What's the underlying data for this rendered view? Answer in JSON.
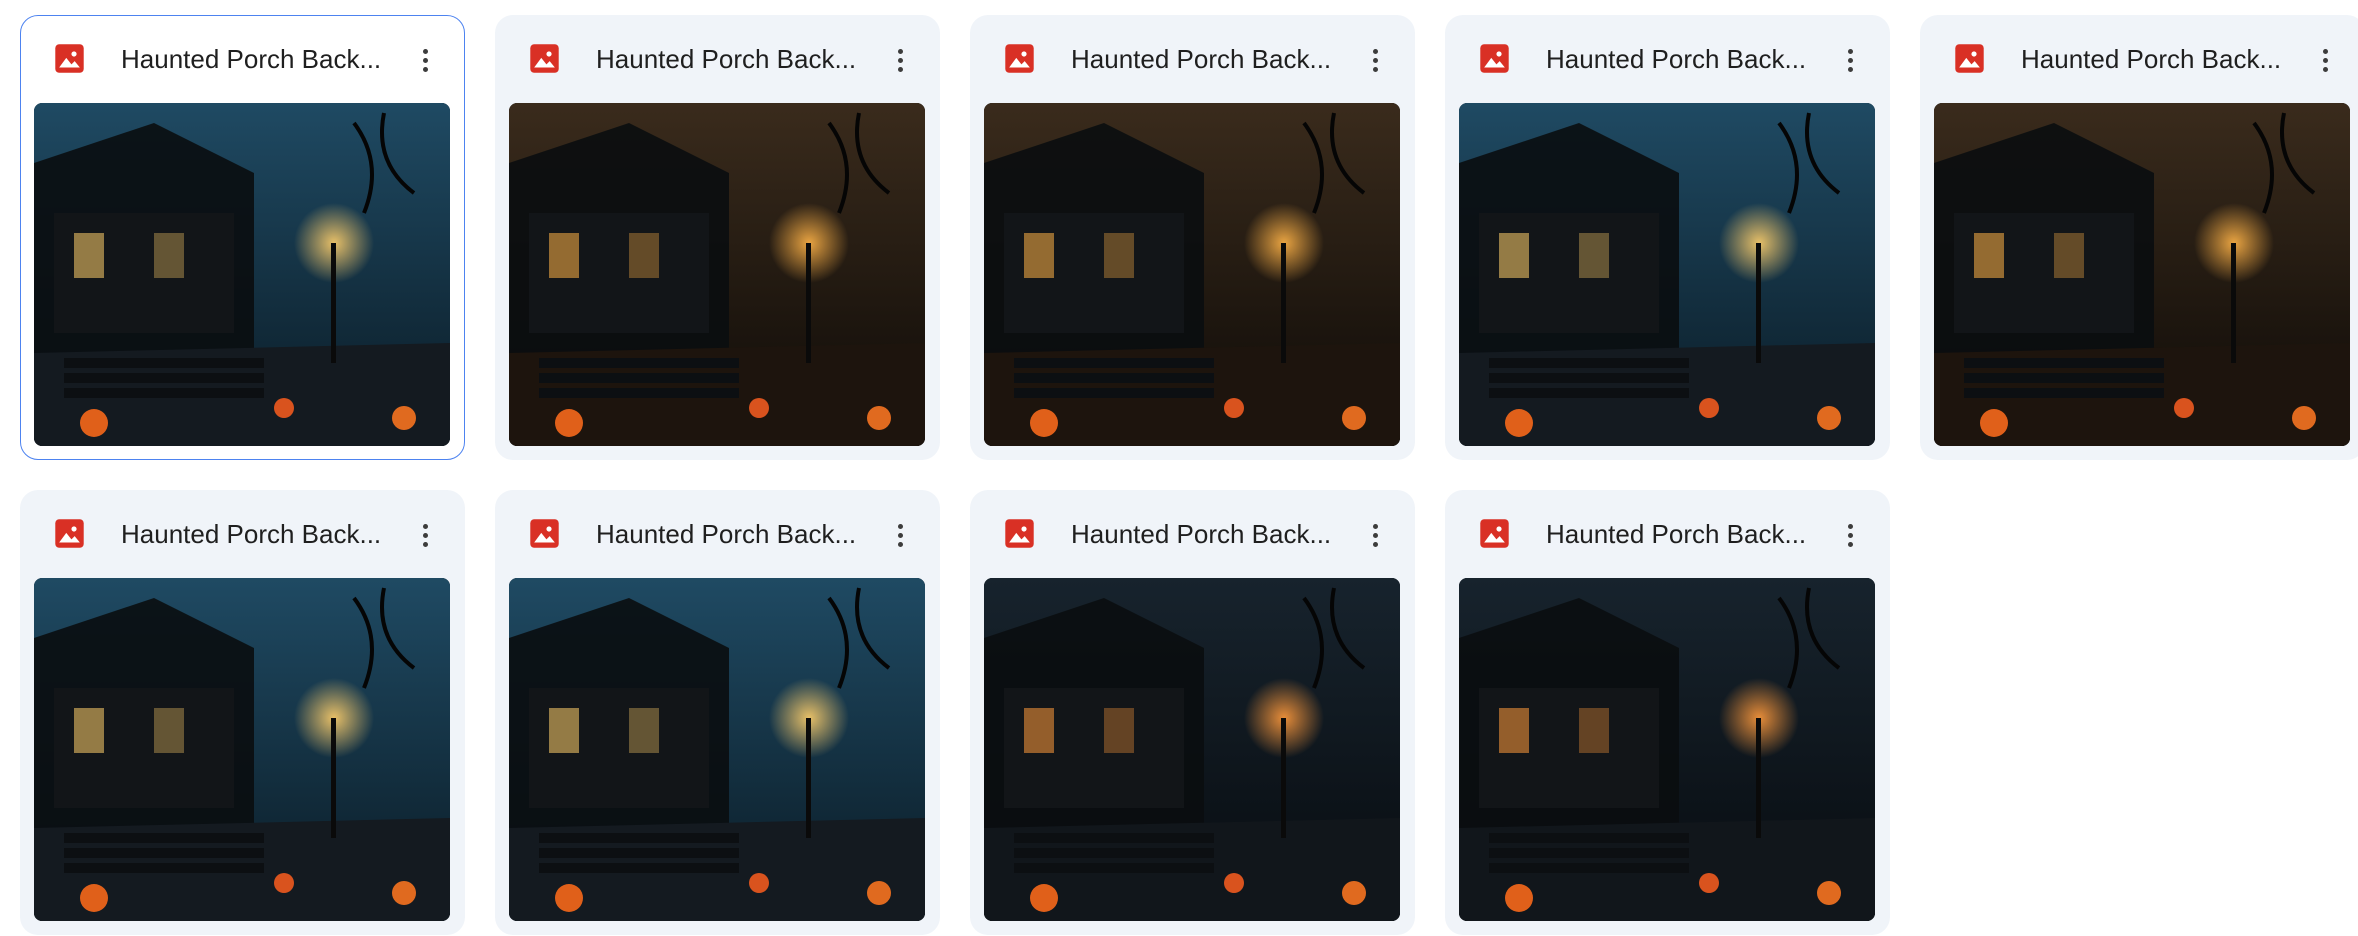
{
  "files": [
    {
      "title": "Haunted Porch Back...",
      "selected": true,
      "theme": "blue",
      "icon": "image-file-icon"
    },
    {
      "title": "Haunted Porch Back...",
      "selected": false,
      "theme": "amber",
      "icon": "image-file-icon"
    },
    {
      "title": "Haunted Porch Back...",
      "selected": false,
      "theme": "amber",
      "icon": "image-file-icon"
    },
    {
      "title": "Haunted Porch Back...",
      "selected": false,
      "theme": "blue",
      "icon": "image-file-icon"
    },
    {
      "title": "Haunted Porch Back...",
      "selected": false,
      "theme": "amber",
      "icon": "image-file-icon"
    },
    {
      "title": "Haunted Porch Back...",
      "selected": false,
      "theme": "blue",
      "icon": "image-file-icon"
    },
    {
      "title": "Haunted Porch Back...",
      "selected": false,
      "theme": "blue",
      "icon": "image-file-icon"
    },
    {
      "title": "Haunted Porch Back...",
      "selected": false,
      "theme": "dark",
      "icon": "image-file-icon"
    },
    {
      "title": "Haunted Porch Back...",
      "selected": false,
      "theme": "dark",
      "icon": "image-file-icon"
    }
  ],
  "colors": {
    "icon_red": "#d93025",
    "selected_border": "#4d83f0",
    "card_bg": "#f0f4f9"
  }
}
